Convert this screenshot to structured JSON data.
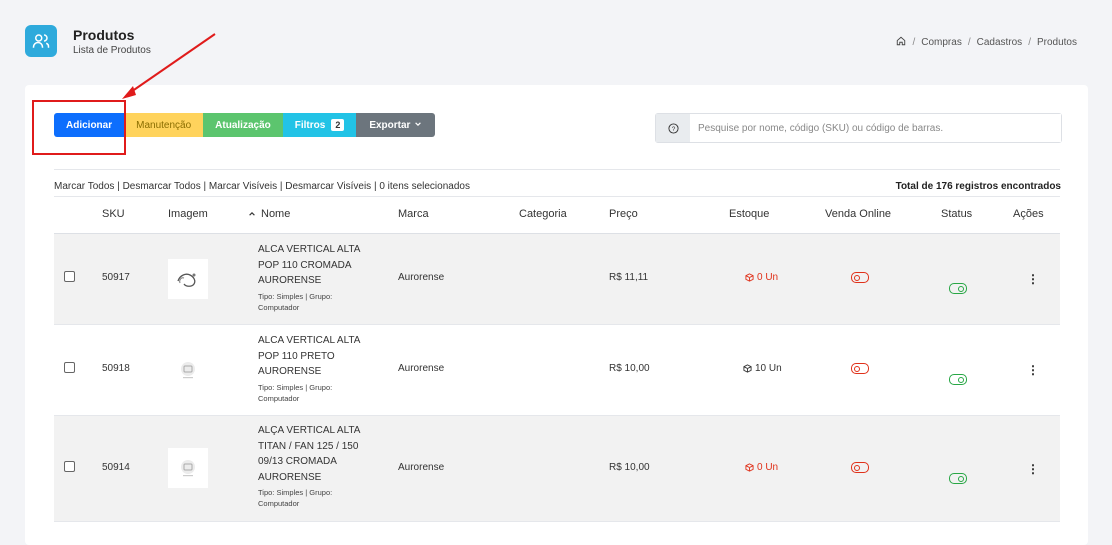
{
  "header": {
    "title": "Produtos",
    "subtitle": "Lista de Produtos",
    "icon": "users-icon",
    "breadcrumb": [
      "Compras",
      "Cadastros",
      "Produtos"
    ]
  },
  "toolbar": {
    "add_label": "Adicionar",
    "maintenance_label": "Manutenção",
    "update_label": "Atualização",
    "filters_label": "Filtros",
    "filters_count": "2",
    "export_label": "Exportar"
  },
  "search": {
    "placeholder": "Pesquise por nome, código (SKU) ou código de barras.",
    "help_icon": "?"
  },
  "selection": {
    "mark_all": "Marcar Todos",
    "unmark_all": "Desmarcar Todos",
    "mark_visible": "Marcar Visíveis",
    "unmark_visible": "Desmarcar Visíveis",
    "selected": "0 itens selecionados",
    "total": "Total de 176 registros encontrados"
  },
  "table": {
    "columns": [
      "SKU",
      "Imagem",
      "Nome",
      "Marca",
      "Categoria",
      "Preço",
      "Estoque",
      "Venda Online",
      "Status",
      "Ações"
    ],
    "rows": [
      {
        "sku": "50917",
        "name_lines": [
          "ALCA VERTICAL ALTA",
          "POP 110 CROMADA",
          "AURORENSE"
        ],
        "meta_lines": [
          "Tipo: Simples | Grupo:",
          "Computador"
        ],
        "brand": "Aurorense",
        "category": "",
        "price": "R$ 11,11",
        "stock": "0 Un",
        "stock_status": "empty",
        "online": false,
        "status": true
      },
      {
        "sku": "50918",
        "name_lines": [
          "ALCA VERTICAL ALTA",
          "POP 110 PRETO",
          "AURORENSE"
        ],
        "meta_lines": [
          "Tipo: Simples | Grupo:",
          "Computador"
        ],
        "brand": "Aurorense",
        "category": "",
        "price": "R$ 10,00",
        "stock": "10 Un",
        "stock_status": "ok",
        "online": false,
        "status": true
      },
      {
        "sku": "50914",
        "name_lines": [
          "ALÇA VERTICAL ALTA",
          "TITAN / FAN 125 / 150",
          "09/13 CROMADA",
          "AURORENSE"
        ],
        "meta_lines": [
          "Tipo: Simples | Grupo:",
          "Computador"
        ],
        "brand": "Aurorense",
        "category": "",
        "price": "R$ 10,00",
        "stock": "0 Un",
        "stock_status": "empty",
        "online": false,
        "status": true
      }
    ]
  },
  "colors": {
    "primary": "#0d6efd",
    "warning": "#ffd35c",
    "success": "#5cc56e",
    "info": "#22c3e6",
    "secondary": "#6c757d",
    "danger": "#e0311a",
    "annotation": "#e01b1b"
  }
}
